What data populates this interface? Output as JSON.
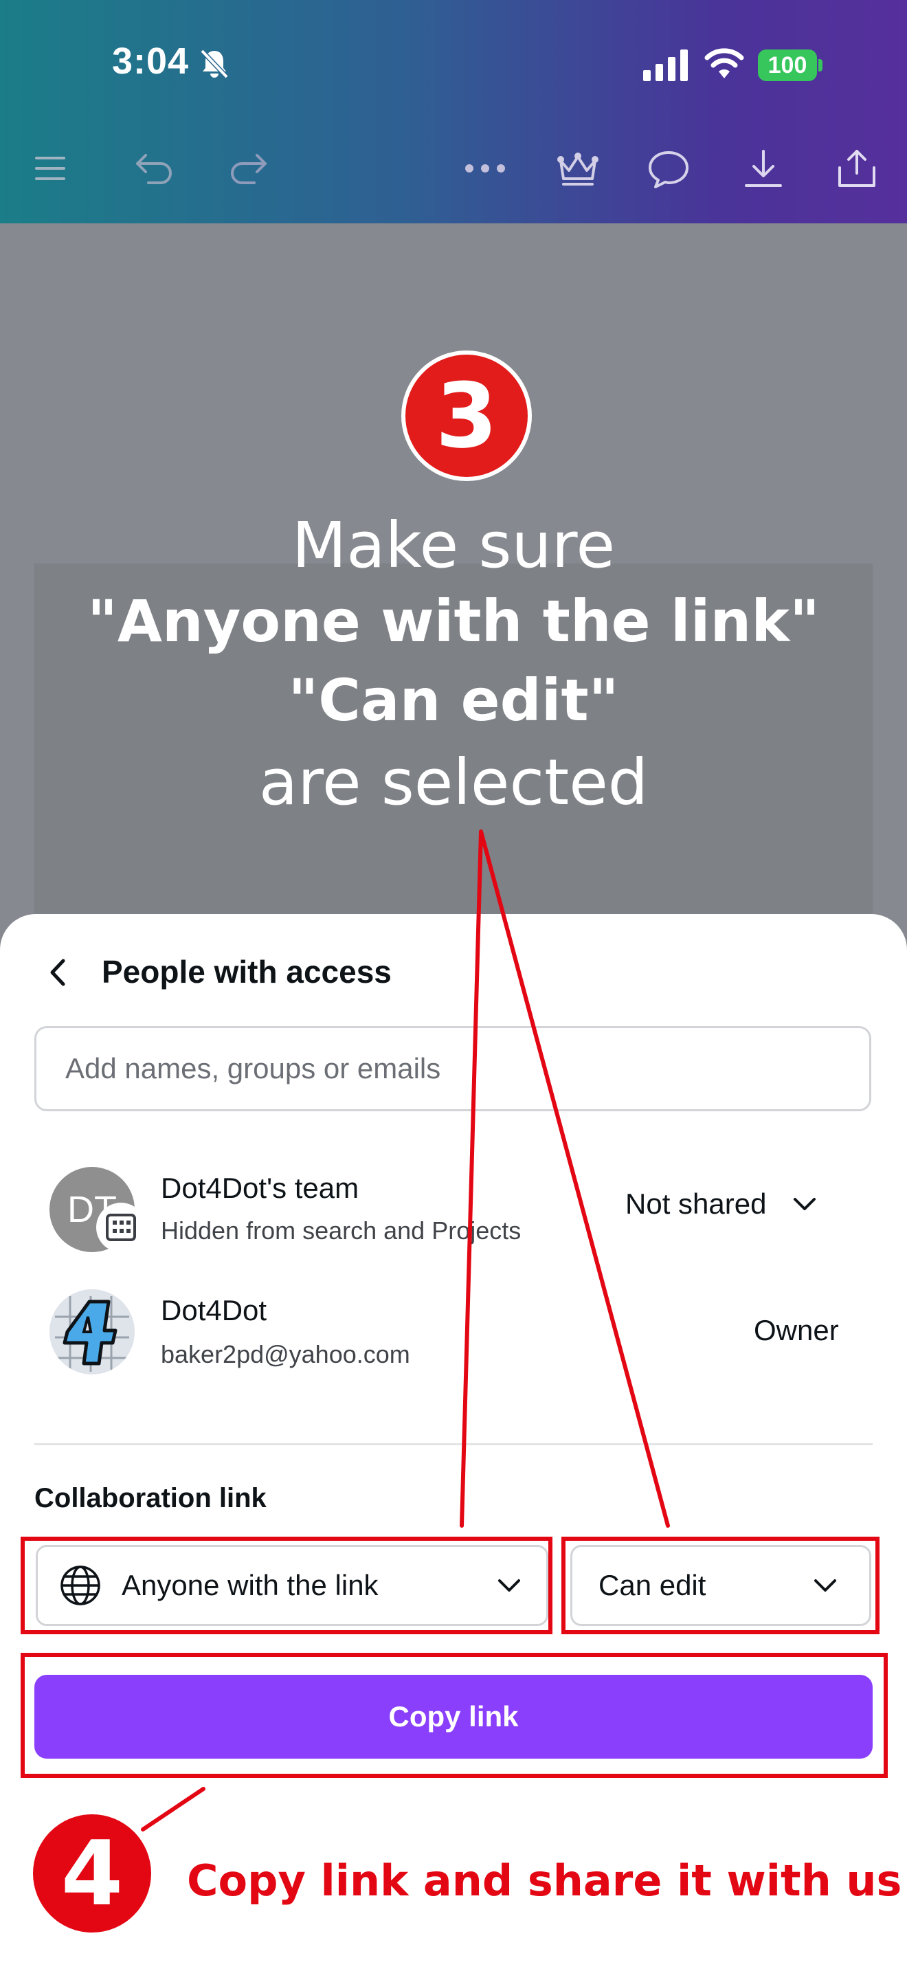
{
  "status_bar": {
    "time": "3:04",
    "battery": "100"
  },
  "toolbar": {
    "icons": [
      "menu-icon",
      "undo-icon",
      "redo-icon",
      "more-icon",
      "crown-icon",
      "comment-icon",
      "download-icon",
      "share-icon"
    ]
  },
  "annotation": {
    "step3_number": "3",
    "line1": "Make sure",
    "line2": "\"Anyone with the link\"",
    "line3": "\"Can edit\"",
    "line4": "are selected",
    "step4_number": "4",
    "step4_text": "Copy link and share it with us",
    "color": "#e30613"
  },
  "sheet": {
    "title": "People with access",
    "search_placeholder": "Add names, groups or emails",
    "people": [
      {
        "initials": "DT",
        "name": "Dot4Dot's team",
        "detail": "Hidden from search and Projects",
        "access": "Not shared"
      },
      {
        "initials": "4",
        "name": "Dot4Dot",
        "detail": "baker2pd@yahoo.com",
        "access": "Owner"
      }
    ],
    "collab_label": "Collaboration link",
    "link_scope": "Anyone with the link",
    "permission": "Can edit",
    "copy_button": "Copy link",
    "accent": "#8a3ffc"
  }
}
